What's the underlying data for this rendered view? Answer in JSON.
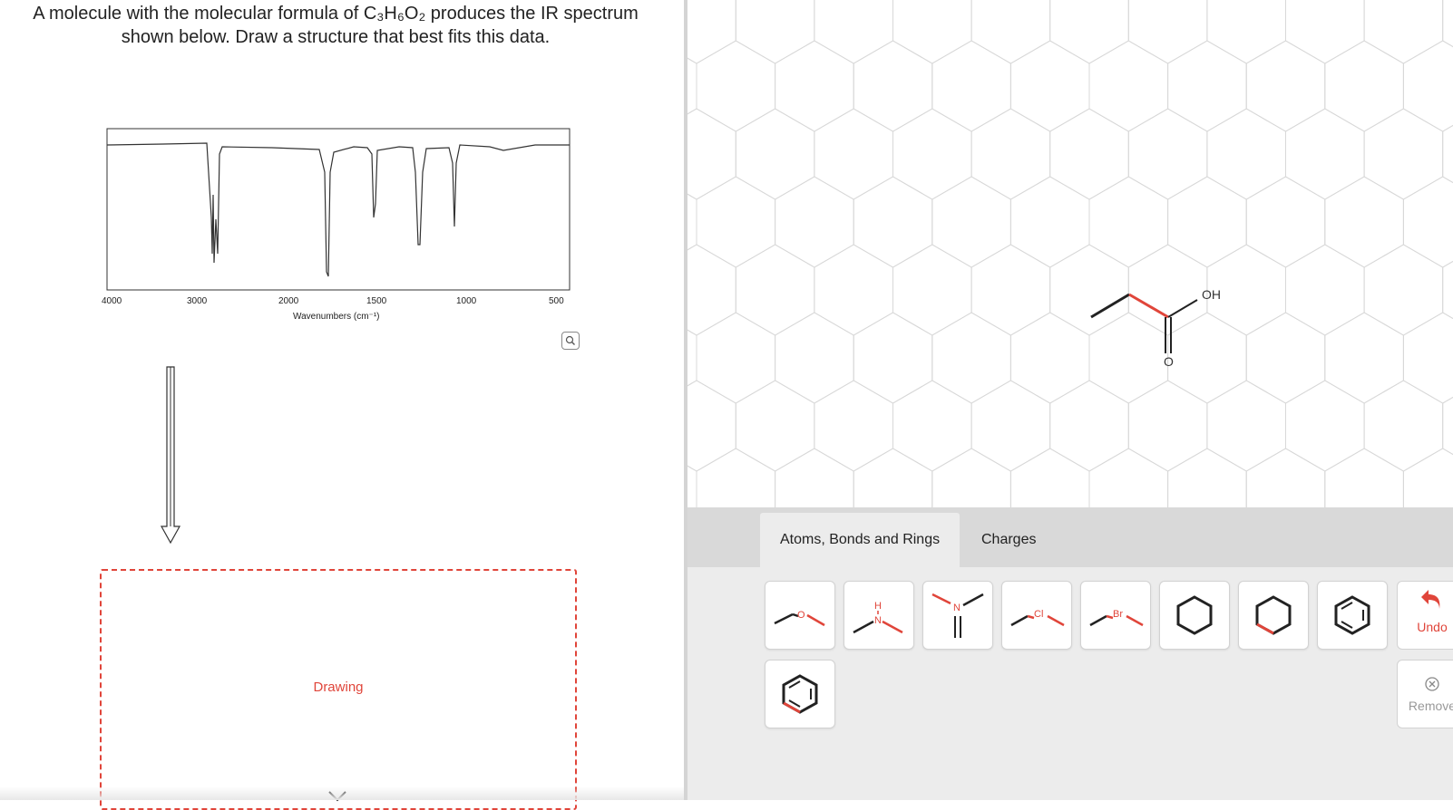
{
  "question": {
    "line1": "A molecule with the molecular formula of C₃H₆O₂ produces the IR spectrum",
    "line2": "shown below. Draw a structure that best fits this data."
  },
  "spectrum": {
    "x_ticks": [
      "4000",
      "3000",
      "2000",
      "1500",
      "1000",
      "500"
    ],
    "xlabel": "Wavenumbers (cm⁻¹)"
  },
  "drawing": {
    "label": "Drawing"
  },
  "molecule": {
    "oh_label": "OH",
    "o_label": "O"
  },
  "tabs": [
    {
      "label": "Atoms, Bonds and Rings",
      "active": true
    },
    {
      "label": "Charges",
      "active": false
    }
  ],
  "tools": {
    "ether_o": "O",
    "amine_h": "H",
    "amine_n": "N",
    "imine_n": "N",
    "chloro": "Cl",
    "bromo": "Br"
  },
  "actions": {
    "undo": "Undo",
    "remove": "Remove"
  },
  "colors": {
    "accent": "#e0453a",
    "bond": "#222222",
    "grid": "#d8d8d8"
  }
}
